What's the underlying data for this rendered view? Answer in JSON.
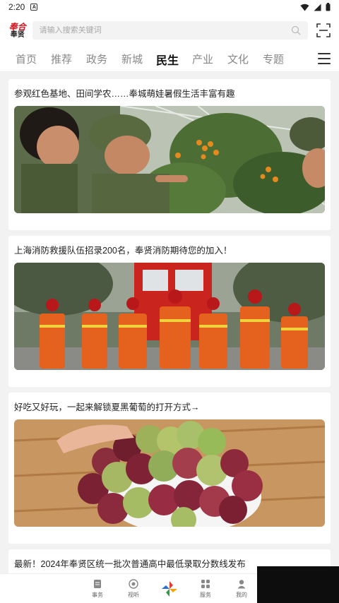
{
  "status": {
    "time": "2:20",
    "notif_glyph": "A"
  },
  "brand": {
    "logo_line1": "奉合",
    "logo_line2": "奉贤",
    "accent": "#d8141c"
  },
  "search": {
    "placeholder": "请输入搜索关键词"
  },
  "tabs": [
    {
      "label": "首页",
      "active": false
    },
    {
      "label": "推荐",
      "active": false
    },
    {
      "label": "政务",
      "active": false
    },
    {
      "label": "新城",
      "active": false
    },
    {
      "label": "民生",
      "active": true
    },
    {
      "label": "产业",
      "active": false
    },
    {
      "label": "文化",
      "active": false
    },
    {
      "label": "专题",
      "active": false
    }
  ],
  "articles": [
    {
      "title": "参观红色基地、田间学农……奉城萌娃暑假生活丰富有趣"
    },
    {
      "title": "上海消防救援队伍招录200名，奉贤消防期待您的加入！"
    },
    {
      "title": "好吃又好玩，一起来解锁夏黑葡萄的打开方式→"
    },
    {
      "title": "最新！2024年奉贤区统一批次普通高中最低录取分数线发布"
    }
  ],
  "bottom_nav": [
    {
      "label": "事务",
      "icon": "document-icon"
    },
    {
      "label": "视听",
      "icon": "play-icon"
    },
    {
      "label": "",
      "icon": "pinwheel-logo-icon"
    },
    {
      "label": "服务",
      "icon": "grid-icon"
    },
    {
      "label": "我的",
      "icon": "user-icon"
    }
  ]
}
